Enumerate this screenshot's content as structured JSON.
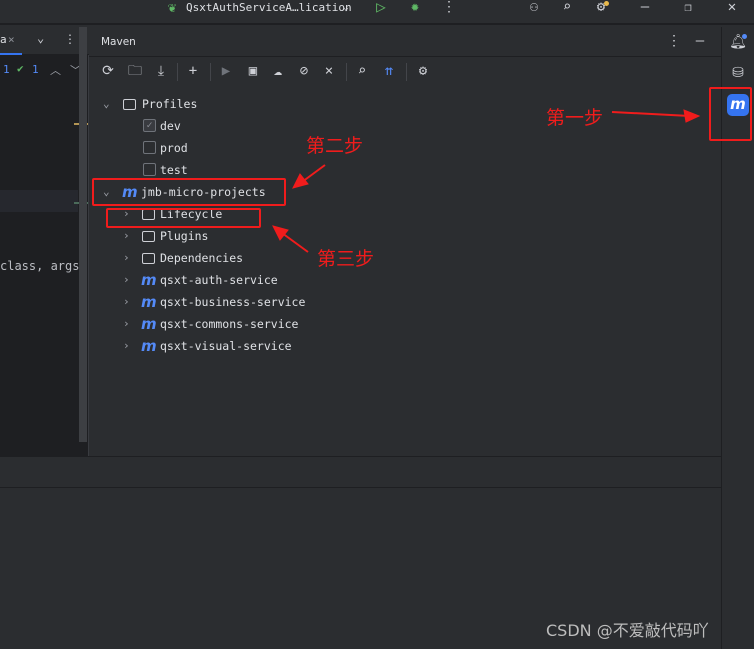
{
  "topbar": {
    "run_config": "QsxtAuthServiceA…lication",
    "icons": [
      "spring-icon",
      "chevron-down-icon",
      "run-icon",
      "debug-icon",
      "more-icon",
      "add-user-icon",
      "search-icon",
      "settings-icon",
      "minimize-icon",
      "restore-icon",
      "close-icon"
    ]
  },
  "editor": {
    "tab_label": "a",
    "problems": {
      "warnings": "1",
      "ok": "1"
    },
    "code_fragment": "class, args"
  },
  "maven": {
    "title": "Maven",
    "toolbar": [
      "reload-icon",
      "folder-refresh-icon",
      "download-icon",
      "add-icon",
      "run-icon",
      "execute-goal-icon",
      "offline-icon",
      "skip-tests-icon",
      "collapse-icon",
      "analyze-icon",
      "show-deps-icon",
      "settings-icon"
    ],
    "profiles": {
      "label": "Profiles",
      "items": [
        {
          "label": "dev",
          "checked": true
        },
        {
          "label": "prod",
          "checked": false
        },
        {
          "label": "test",
          "checked": false
        }
      ]
    },
    "root": {
      "label": "jmb-micro-projects",
      "children": [
        "Lifecycle",
        "Plugins",
        "Dependencies"
      ],
      "modules": [
        "qsxt-auth-service",
        "qsxt-business-service",
        "qsxt-commons-service",
        "qsxt-visual-service"
      ]
    }
  },
  "sidebar": {
    "icons": [
      "notifications-icon",
      "database-icon",
      "maven-icon"
    ],
    "maven_letter": "m"
  },
  "annotations": {
    "step1": "第一步",
    "step2": "第二步",
    "step3": "第三步",
    "color": "#f01c1c"
  },
  "watermark": "CSDN @不爱敲代码吖"
}
